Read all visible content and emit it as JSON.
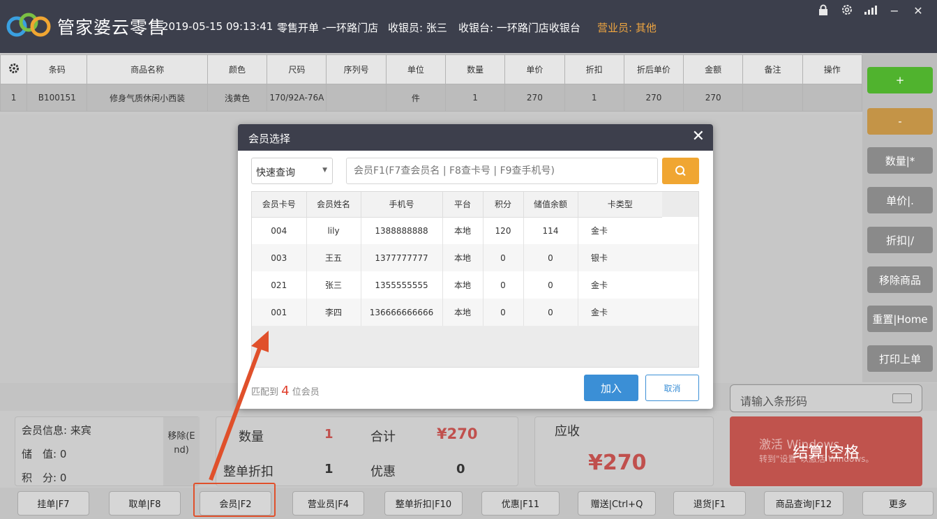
{
  "header": {
    "app_title": "管家婆云零售",
    "datetime": "2019-05-15 09:13:41",
    "order_status": "零售开单 -一环路门店",
    "cashier": "收银员: 张三",
    "register": "收银台: 一环路门店收银台",
    "salesperson": "营业员: 其他",
    "window_controls": [
      "lock-icon",
      "settings-icon",
      "signal-icon",
      "minimize-icon",
      "close-icon"
    ]
  },
  "product_table": {
    "columns": [
      "条码",
      "商品名称",
      "颜色",
      "尺码",
      "序列号",
      "单位",
      "数量",
      "单价",
      "折扣",
      "折后单价",
      "金额",
      "备注",
      "操作"
    ],
    "rows": [
      [
        "1",
        "B100151",
        "修身气质休闲小西装",
        "浅黄色",
        "170/92A-76A",
        "",
        "件",
        "1",
        "270",
        "1",
        "270",
        "270",
        "",
        ""
      ]
    ]
  },
  "sidebar": {
    "plus": "+",
    "minus": "-",
    "quantity": "数量|*",
    "price": "单价|.",
    "discount": "折扣|/",
    "remove": "移除商品",
    "reset": "重置|Home",
    "print_last": "打印上单"
  },
  "member_panel": {
    "info": "会员信息: 来宾",
    "stored_value": "储　值: 0",
    "points": "积　分: 0",
    "remove_label": "移除(End)"
  },
  "summary": {
    "qty_label": "数量",
    "qty_value": "1",
    "total_label": "合计",
    "total_value": "¥270",
    "discount_label": "整单折扣",
    "discount_value": "1",
    "promo_label": "优惠",
    "promo_value": "0"
  },
  "receivable": {
    "label": "应收",
    "value": "¥270"
  },
  "barcode": {
    "placeholder": "请输入条形码"
  },
  "checkout": {
    "label": "结算|空格",
    "activation_title": "激活 Windows",
    "activation_hint": "转到\"设置\"以激活 Windows。"
  },
  "function_bar": [
    "挂单|F7",
    "取单|F8",
    "会员|F2",
    "营业员|F4",
    "整单折扣|F10",
    "优惠|F11",
    "赠送|Ctrl+Q",
    "退货|F1",
    "商品查询|F12",
    "更多"
  ],
  "dialog": {
    "title": "会员选择",
    "select_value": "快速查询",
    "search_placeholder": "会员F1(F7查会员名 | F8查卡号 | F9查手机号)",
    "columns": [
      "会员卡号",
      "会员姓名",
      "手机号",
      "平台",
      "积分",
      "储值余额",
      "卡类型"
    ],
    "rows": [
      [
        "004",
        "lily",
        "1388888888",
        "本地",
        "120",
        "114",
        "金卡"
      ],
      [
        "003",
        "王五",
        "1377777777",
        "本地",
        "0",
        "0",
        "银卡"
      ],
      [
        "021",
        "张三",
        "1355555555",
        "本地",
        "0",
        "0",
        "金卡"
      ],
      [
        "001",
        "李四",
        "136666666666",
        "本地",
        "0",
        "0",
        "金卡"
      ]
    ],
    "match_prefix": "匹配到",
    "match_count": "4",
    "match_suffix": "位会员",
    "join_label": "加入",
    "cancel_label": "取消"
  },
  "colors": {
    "header_bg": "#3c3f4c",
    "accent_orange": "#f0a632",
    "primary_blue": "#3b8fd6",
    "annotation_red": "#e0502b",
    "checkout_red": "#c0534d",
    "green": "#50b32e"
  }
}
